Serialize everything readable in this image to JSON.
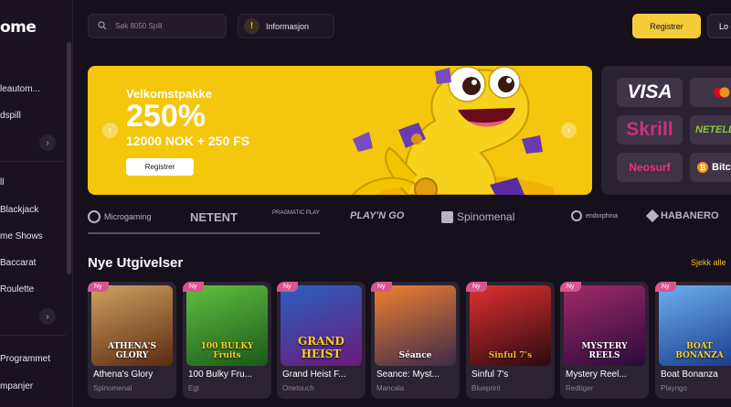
{
  "brand": {
    "logo_text": "ome"
  },
  "sidebar": {
    "items": [
      {
        "label": "leautom..."
      },
      {
        "label": "dspill"
      },
      {
        "label": "ll"
      },
      {
        "label": "Blackjack"
      },
      {
        "label": "me Shows"
      },
      {
        "label": "Baccarat"
      },
      {
        "label": "Roulette"
      },
      {
        "label": "Programmet"
      },
      {
        "label": "mpanjer"
      }
    ]
  },
  "header": {
    "search_placeholder": "Søk 8050 Spill",
    "info_label": "Informasjon",
    "info_icon_glyph": "!",
    "register_label": "Registrer",
    "login_label": "Lo"
  },
  "banner": {
    "subtitle": "Velkomstpakke",
    "headline": "250%",
    "offer": "12000 NOK + 250 FS",
    "cta": "Registrer"
  },
  "payments": [
    {
      "name": "VISA"
    },
    {
      "name": "mastercard"
    },
    {
      "name": "Skrill"
    },
    {
      "name": "NETELLER"
    },
    {
      "name": "Neosurf"
    },
    {
      "name": "Bitcoin",
      "display": "Bitc"
    }
  ],
  "providers": [
    {
      "name": "Microgaming"
    },
    {
      "name": "NETENT"
    },
    {
      "name": "PRAGMATIC PLAY"
    },
    {
      "name": "PLAY'N GO"
    },
    {
      "name": "Spinomenal"
    },
    {
      "name": "endorphina"
    },
    {
      "name": "HABANERO"
    }
  ],
  "new_releases": {
    "title": "Nye Utgivelser",
    "see_all": "Sjekk alle",
    "badge": "Ny",
    "games": [
      {
        "name": "Athena's Glory",
        "provider": "Spinomenal",
        "thumb_text": "ATHENA'S GLORY",
        "color": "#8a4a20"
      },
      {
        "name": "100 Bulky Fru...",
        "provider": "Egt",
        "thumb_text": "100 BULKY Fruits",
        "color": "#2e8a2a"
      },
      {
        "name": "Grand Heist F...",
        "provider": "Onetouch",
        "thumb_text": "GRAND HEIST",
        "color": "#6a1a7a"
      },
      {
        "name": "Seance: Myst...",
        "provider": "Mancala",
        "thumb_text": "Séance",
        "color": "#c85a20"
      },
      {
        "name": "Sinful 7's",
        "provider": "Blueprint",
        "thumb_text": "Sinful 7's",
        "color": "#4a1010"
      },
      {
        "name": "Mystery Reel...",
        "provider": "Redtiger",
        "thumb_text": "MYSTERY REELS",
        "color": "#5a1a4a"
      },
      {
        "name": "Boat Bonanza",
        "provider": "Playngo",
        "thumb_text": "BOAT BONANZA",
        "color": "#2a5aa0"
      }
    ]
  },
  "colors": {
    "accent": "#f7cc3a",
    "banner": "#f4c60c",
    "badge": "#d9558e",
    "background": "#160f1c"
  }
}
